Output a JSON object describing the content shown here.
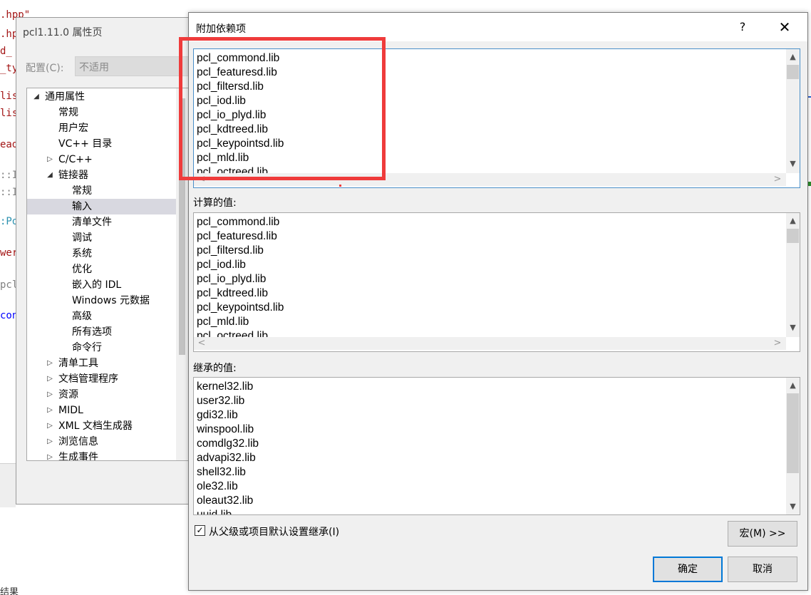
{
  "editor": {
    "code_lines": [
      {
        "text": ".hpp\"",
        "cls": "c-red"
      },
      {
        "text": ".hpp\"",
        "cls": "c-red"
      },
      {
        "text": "d_",
        "cls": "c-red"
      },
      {
        "text": "_ty",
        "cls": "c-red"
      },
      {
        "text": "lis",
        "cls": "c-red"
      },
      {
        "text": "lis",
        "cls": "c-red"
      },
      {
        "text": "ead",
        "cls": "c-red"
      },
      {
        "text": "::I",
        "cls": "c-grey"
      },
      {
        "text": "::I",
        "cls": "c-grey"
      },
      {
        "text": ":Po",
        "cls": "c-blue"
      },
      {
        "text": "wer",
        "cls": "c-red"
      },
      {
        "text": "pcl",
        "cls": "c-grey"
      },
      {
        "text": "con",
        "cls": "c-navy"
      }
    ],
    "status_text": "结果"
  },
  "prop_window": {
    "title": "pcl1.11.0 属性页",
    "config_label": "配置(C):",
    "config_value": "不适用",
    "tree": [
      {
        "label": "通用属性",
        "arrow": "◢",
        "level": 0
      },
      {
        "label": "常规",
        "arrow": "",
        "level": 1
      },
      {
        "label": "用户宏",
        "arrow": "",
        "level": 1
      },
      {
        "label": "VC++ 目录",
        "arrow": "",
        "level": 1
      },
      {
        "label": "C/C++",
        "arrow": "▷",
        "level": 1
      },
      {
        "label": "链接器",
        "arrow": "◢",
        "level": 1
      },
      {
        "label": "常规",
        "arrow": "",
        "level": 2
      },
      {
        "label": "输入",
        "arrow": "",
        "level": 2,
        "selected": true
      },
      {
        "label": "清单文件",
        "arrow": "",
        "level": 2
      },
      {
        "label": "调试",
        "arrow": "",
        "level": 2
      },
      {
        "label": "系统",
        "arrow": "",
        "level": 2
      },
      {
        "label": "优化",
        "arrow": "",
        "level": 2
      },
      {
        "label": "嵌入的 IDL",
        "arrow": "",
        "level": 2
      },
      {
        "label": "Windows 元数据",
        "arrow": "",
        "level": 2
      },
      {
        "label": "高级",
        "arrow": "",
        "level": 2
      },
      {
        "label": "所有选项",
        "arrow": "",
        "level": 2
      },
      {
        "label": "命令行",
        "arrow": "",
        "level": 2
      },
      {
        "label": "清单工具",
        "arrow": "▷",
        "level": 1
      },
      {
        "label": "文档管理程序",
        "arrow": "▷",
        "level": 1
      },
      {
        "label": "资源",
        "arrow": "▷",
        "level": 1
      },
      {
        "label": "MIDL",
        "arrow": "▷",
        "level": 1
      },
      {
        "label": "XML 文档生成器",
        "arrow": "▷",
        "level": 1
      },
      {
        "label": "浏览信息",
        "arrow": "▷",
        "level": 1
      },
      {
        "label": "生成事件",
        "arrow": "▷",
        "level": 1
      }
    ]
  },
  "dialog": {
    "title": "附加依赖项",
    "help_label": "?",
    "close_label": "✕",
    "edit_lines": [
      "pcl_commond.lib",
      "pcl_featuresd.lib",
      "pcl_filtersd.lib",
      "pcl_iod.lib",
      "pcl_io_plyd.lib",
      "pcl_kdtreed.lib",
      "pcl_keypointsd.lib",
      "pcl_mld.lib",
      "pcl_octreed.lib"
    ],
    "computed_label": "计算的值:",
    "computed_lines": [
      "pcl_commond.lib",
      "pcl_featuresd.lib",
      "pcl_filtersd.lib",
      "pcl_iod.lib",
      "pcl_io_plyd.lib",
      "pcl_kdtreed.lib",
      "pcl_keypointsd.lib",
      "pcl_mld.lib",
      "pcl_octreed.lib"
    ],
    "inherited_label": "继承的值:",
    "inherited_lines": [
      "kernel32.lib",
      "user32.lib",
      "gdi32.lib",
      "winspool.lib",
      "comdlg32.lib",
      "advapi32.lib",
      "shell32.lib",
      "ole32.lib",
      "oleaut32.lib",
      "uuid.lib"
    ],
    "inherit_checkbox_label": "从父级或项目默认设置继承(I)",
    "inherit_checked": true,
    "macro_button": "宏(M) >>",
    "ok_button": "确定",
    "cancel_button": "取消"
  },
  "colors": {
    "highlight_border": "#ef3b3b",
    "default_button_border": "#0078d7"
  },
  "icons": {
    "scroll_up": "▲",
    "scroll_down": "▼",
    "scroll_left": "<",
    "scroll_right": ">"
  }
}
